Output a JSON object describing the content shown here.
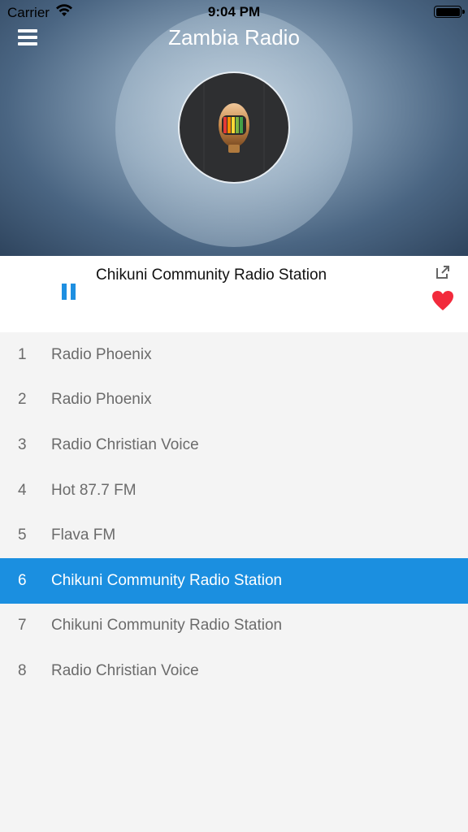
{
  "status_bar": {
    "carrier": "Carrier",
    "time": "9:04 PM"
  },
  "header": {
    "title": "Zambia Radio",
    "menu_icon": "hamburger-menu-icon"
  },
  "player": {
    "now_playing": "Chikuni Community Radio Station",
    "state": "playing",
    "share_icon": "share-icon",
    "favorite_icon": "heart-icon",
    "favorite_color": "#f22a3c",
    "accent_color": "#1b8fe0"
  },
  "stations": [
    {
      "num": "1",
      "name": "Radio Phoenix"
    },
    {
      "num": "2",
      "name": "Radio Phoenix"
    },
    {
      "num": "3",
      "name": "Radio Christian Voice"
    },
    {
      "num": "4",
      "name": "Hot 87.7 FM"
    },
    {
      "num": "5",
      "name": "Flava FM"
    },
    {
      "num": "6",
      "name": "Chikuni Community Radio Station"
    },
    {
      "num": "7",
      "name": "Chikuni Community Radio Station"
    },
    {
      "num": "8",
      "name": "Radio Christian Voice"
    }
  ],
  "selected_index": 5
}
